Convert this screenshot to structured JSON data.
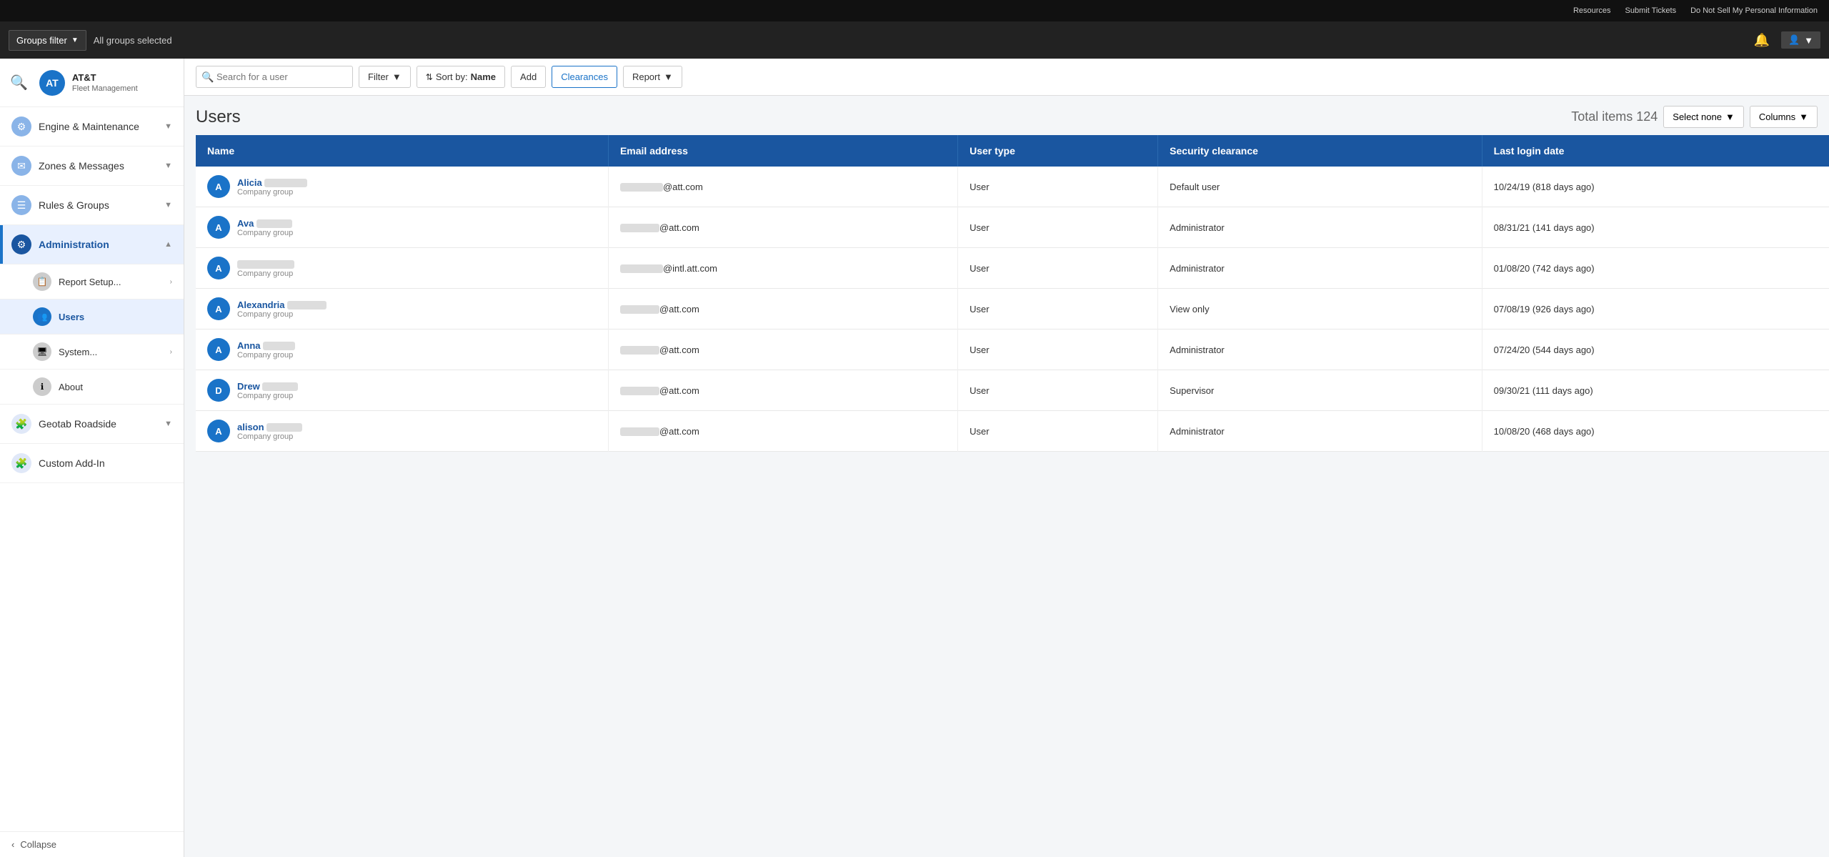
{
  "topbar": {
    "links": [
      "Resources",
      "Submit Tickets",
      "Do Not Sell My Personal Information"
    ]
  },
  "groupsbar": {
    "filter_label": "Groups filter",
    "all_groups_text": "All groups selected"
  },
  "logo": {
    "company": "AT&T",
    "subtitle": "Fleet Management"
  },
  "sidebar": {
    "nav_items": [
      {
        "id": "engine",
        "label": "Engine & Maintenance",
        "icon": "⚙",
        "has_sub": true,
        "expanded": false
      },
      {
        "id": "zones",
        "label": "Zones & Messages",
        "icon": "✉",
        "has_sub": true,
        "expanded": false
      },
      {
        "id": "rules",
        "label": "Rules & Groups",
        "icon": "☰",
        "has_sub": true,
        "expanded": false
      },
      {
        "id": "admin",
        "label": "Administration",
        "icon": "⚙",
        "has_sub": true,
        "expanded": true,
        "active": true
      }
    ],
    "admin_sub": [
      {
        "id": "report-setup",
        "label": "Report Setup...",
        "has_arrow": true
      },
      {
        "id": "users",
        "label": "Users",
        "active": true
      },
      {
        "id": "system",
        "label": "System...",
        "has_arrow": true
      },
      {
        "id": "about",
        "label": "About"
      }
    ],
    "bottom_items": [
      {
        "id": "geotab-roadside",
        "label": "Geotab Roadside",
        "has_sub": true
      },
      {
        "id": "custom-add-in",
        "label": "Custom Add-In"
      }
    ],
    "collapse_label": "Collapse"
  },
  "toolbar": {
    "search_placeholder": "Search for a user",
    "filter_label": "Filter",
    "sort_label": "Sort by:",
    "sort_value": "Name",
    "add_label": "Add",
    "clearances_label": "Clearances",
    "report_label": "Report"
  },
  "page": {
    "title": "Users",
    "total_label": "Total items 124",
    "select_none_label": "Select none",
    "columns_label": "Columns"
  },
  "table": {
    "columns": [
      "Name",
      "Email address",
      "User type",
      "Security clearance",
      "Last login date"
    ],
    "rows": [
      {
        "initial": "A",
        "name": "Alicia",
        "name_redacted_width": 60,
        "group": "Company group",
        "email_redacted_width": 60,
        "email_domain": "@att.com",
        "user_type": "User",
        "security": "Default user",
        "last_login": "10/24/19 (818 days ago)"
      },
      {
        "initial": "A",
        "name": "Ava",
        "name_redacted_width": 50,
        "group": "Company group",
        "email_redacted_width": 55,
        "email_domain": "@att.com",
        "user_type": "User",
        "security": "Administrator",
        "last_login": "08/31/21 (141 days ago)"
      },
      {
        "initial": "A",
        "name": "",
        "name_redacted_width": 80,
        "group": "Company group",
        "email_redacted_width": 60,
        "email_domain": "@intl.att.com",
        "user_type": "User",
        "security": "Administrator",
        "last_login": "01/08/20 (742 days ago)"
      },
      {
        "initial": "A",
        "name": "Alexandria",
        "name_redacted_width": 55,
        "group": "Company group",
        "email_redacted_width": 55,
        "email_domain": "@att.com",
        "user_type": "User",
        "security": "View only",
        "last_login": "07/08/19 (926 days ago)"
      },
      {
        "initial": "A",
        "name": "Anna",
        "name_redacted_width": 45,
        "group": "Company group",
        "email_redacted_width": 55,
        "email_domain": "@att.com",
        "user_type": "User",
        "security": "Administrator",
        "last_login": "07/24/20 (544 days ago)"
      },
      {
        "initial": "D",
        "name": "Drew",
        "name_redacted_width": 50,
        "group": "Company group",
        "email_redacted_width": 55,
        "email_domain": "@att.com",
        "user_type": "User",
        "security": "Supervisor",
        "last_login": "09/30/21 (111 days ago)"
      },
      {
        "initial": "A",
        "name": "alison",
        "name_redacted_width": 50,
        "group": "Company group",
        "email_redacted_width": 55,
        "email_domain": "@att.com",
        "user_type": "User",
        "security": "Administrator",
        "last_login": "10/08/20 (468 days ago)"
      }
    ]
  }
}
